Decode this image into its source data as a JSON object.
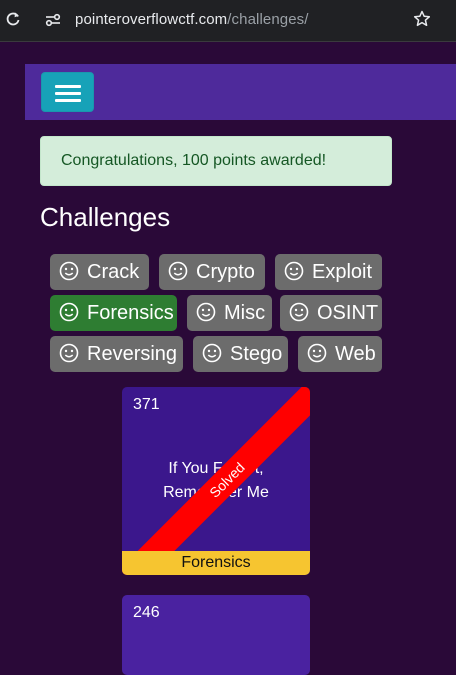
{
  "browser": {
    "url_host": "pointeroverflowctf.com",
    "url_path": "/challenges/"
  },
  "alert": {
    "text": "Congratulations, 100 points awarded!"
  },
  "page_title": "Challenges",
  "categories": [
    {
      "label": "Crack",
      "active": false
    },
    {
      "label": "Crypto",
      "active": false
    },
    {
      "label": "Exploit",
      "active": false
    },
    {
      "label": "Forensics",
      "active": true
    },
    {
      "label": "Misc",
      "active": false
    },
    {
      "label": "OSINT",
      "active": false
    },
    {
      "label": "Reversing",
      "active": false
    },
    {
      "label": "Stego",
      "active": false
    },
    {
      "label": "Web",
      "active": false
    }
  ],
  "cards": [
    {
      "points": "371",
      "title_line1": "If You Forget,",
      "title_line2": "Remember Me",
      "status": "Solved",
      "category": "Forensics"
    },
    {
      "points": "246"
    }
  ],
  "colors": {
    "background": "#2a0938",
    "navbar": "#4e2a9b",
    "menu_button": "#17a2b8",
    "category_active": "#2e7d32",
    "category_inactive": "#6c6c6c",
    "solved_ribbon": "#ff0000",
    "card_footer": "#f6c530"
  }
}
